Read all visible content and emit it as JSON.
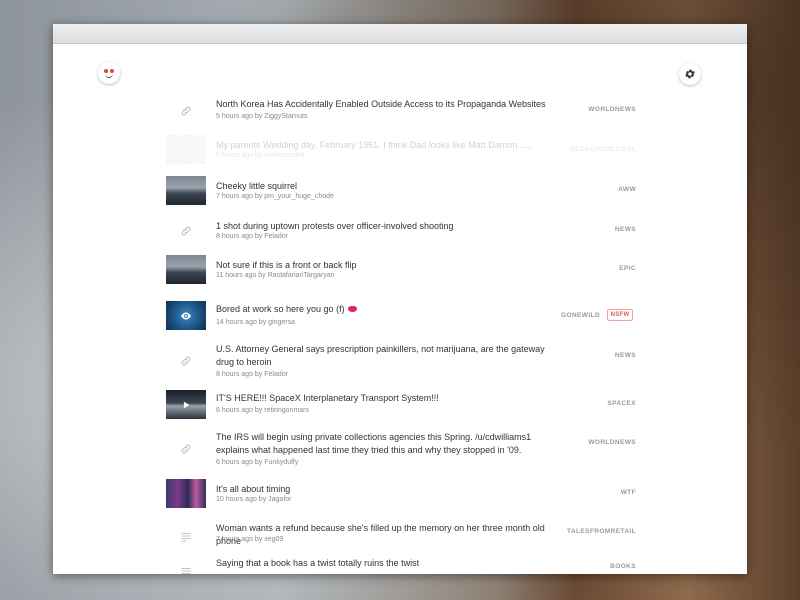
{
  "app": {
    "logo_icon": "reddit-alien-icon",
    "settings_icon": "gear-icon"
  },
  "posts": [
    {
      "title": "North Korea Has Accidentally Enabled Outside Access to its Propaganda Websites",
      "meta": "5 hours ago by ZiggyStarnuts",
      "subreddit": "WORLDNEWS",
      "thumb": "link-icon"
    },
    {
      "title": "My parents Wedding day, February 1961. I think Dad looks like Matt Damon......",
      "meta": "5 hours ago by notheroesleft",
      "subreddit": "OLDSCHOOLCOOL",
      "thumb": "image"
    },
    {
      "title": "Cheeky little squirrel",
      "meta": "7 hours ago by pm_your_huge_chode",
      "subreddit": "AWW",
      "thumb": "image"
    },
    {
      "title": "1 shot during uptown protests over officer-involved shooting",
      "meta": "8 hours ago by Felador",
      "subreddit": "NEWS",
      "thumb": "link-icon"
    },
    {
      "title": "Not sure if this is a front or back flip",
      "meta": "11 hours ago by RastafarianTargaryan",
      "subreddit": "EPIC",
      "thumb": "image"
    },
    {
      "title": "Bored at work so here you go (f)",
      "meta": "14 hours ago by gingersa",
      "subreddit": "GONEWILD",
      "badge": "NSFW",
      "thumb": "eye-icon"
    },
    {
      "title": "U.S. Attorney General says prescription painkillers, not marijuana, are the gateway drug to heroin",
      "meta": "8 hours ago by Felador",
      "subreddit": "NEWS",
      "thumb": "link-icon"
    },
    {
      "title": "IT'S HERE!!! SpaceX Interplanetary Transport System!!!",
      "meta": "6 hours ago by retiringonmars",
      "subreddit": "SPACEX",
      "thumb": "play-icon"
    },
    {
      "title": "The IRS will begin using private collections agencies this Spring. /u/cdwilliams1 explains what happened last time they tried this and why they stopped in '09.",
      "meta": "6 hours ago by Funkyduffy",
      "subreddit": "WORLDNEWS",
      "thumb": "link-icon"
    },
    {
      "title": "It's all about timing",
      "meta": "10 hours ago by Jagafor",
      "subreddit": "WTF",
      "thumb": "image"
    },
    {
      "title": "Woman wants a refund because she's filled up the memory on her three month old phone",
      "meta": "7 hours ago by xeg09",
      "subreddit": "TALESFROMRETAIL",
      "thumb": "text-icon"
    },
    {
      "title": "Saying that a book has a twist totally ruins the twist",
      "meta": "",
      "subreddit": "BOOKS",
      "thumb": "text-icon"
    }
  ]
}
